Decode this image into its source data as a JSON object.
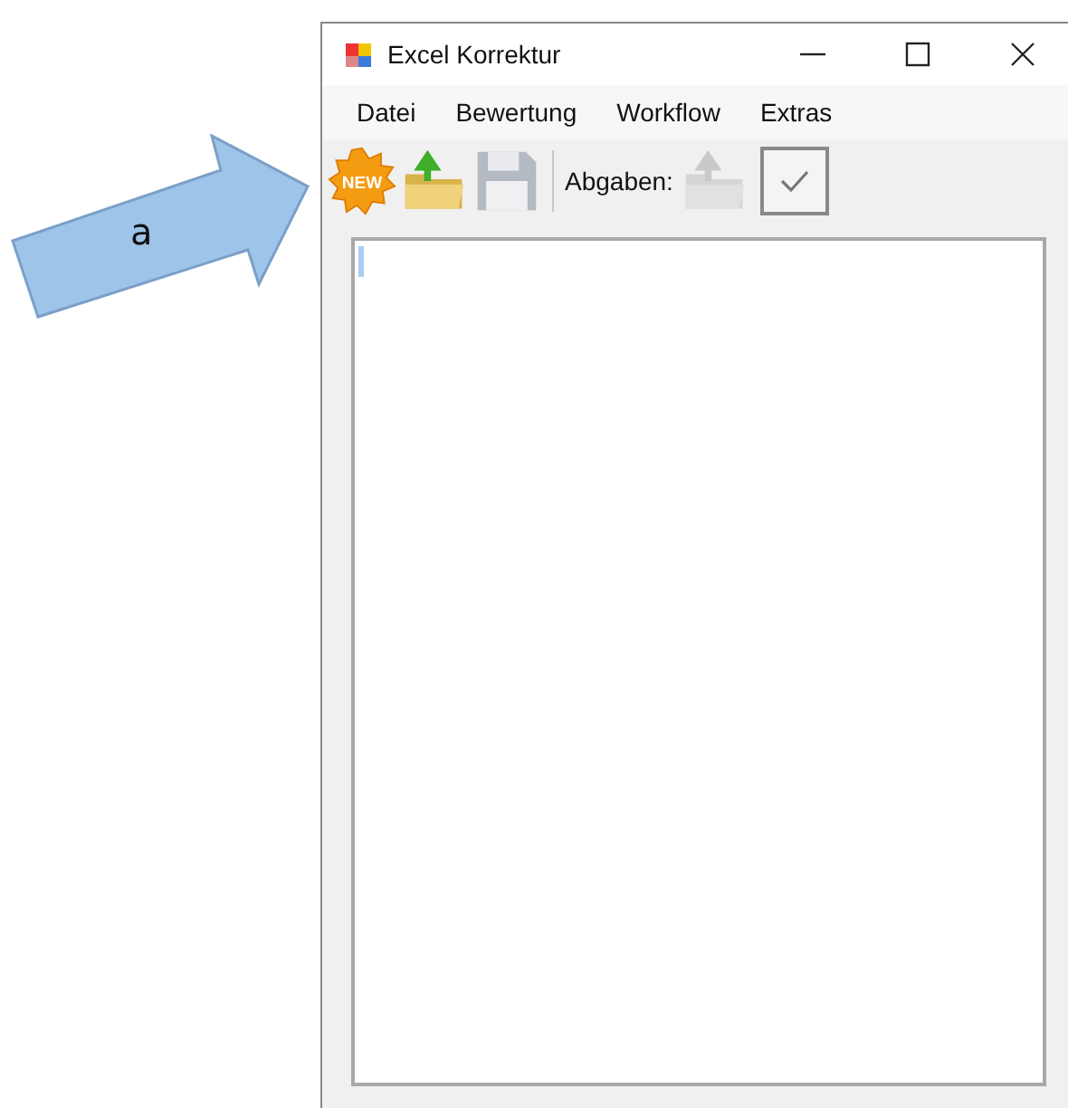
{
  "annotation": {
    "label": "a"
  },
  "window": {
    "title": "Excel Korrektur"
  },
  "menu": [
    {
      "label": "Datei"
    },
    {
      "label": "Bewertung"
    },
    {
      "label": "Workflow"
    },
    {
      "label": "Extras"
    }
  ],
  "toolbar": [
    {
      "kind": "new",
      "text": "NEW",
      "disabled": false
    },
    {
      "kind": "open",
      "disabled": false
    },
    {
      "kind": "save",
      "disabled": true
    },
    {
      "kind": "separator"
    },
    {
      "kind": "label",
      "text": "Abgaben:"
    },
    {
      "kind": "upload",
      "disabled": true
    },
    {
      "kind": "check",
      "disabled": false
    }
  ]
}
